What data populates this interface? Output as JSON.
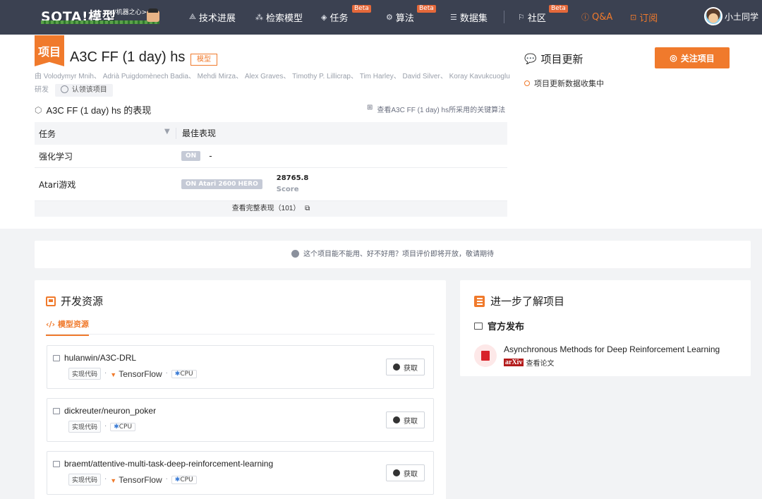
{
  "nav": {
    "logo_text": "SOTA!模型",
    "logo_sub": "</机器之心>",
    "items": [
      {
        "icon": "rocket-icon",
        "label": "技术进展"
      },
      {
        "icon": "nodes-icon",
        "label": "检索模型"
      },
      {
        "icon": "layers-icon",
        "label": "任务",
        "beta": "Beta"
      },
      {
        "icon": "algorithm-icon",
        "label": "算法",
        "beta": "Beta"
      },
      {
        "icon": "database-icon",
        "label": "数据集"
      },
      {
        "icon": "flag-icon",
        "label": "社区",
        "beta": "Beta"
      },
      {
        "icon": "question-icon",
        "label": "Q&A"
      },
      {
        "icon": "bookmark-icon",
        "label": "订阅"
      }
    ],
    "user": "小土同学"
  },
  "project": {
    "ribbon": "项目",
    "title": "A3C FF (1 day) hs",
    "badge": "模型",
    "authors": "由 Volodymyr Mnih、 Adrià Puigdomènech Badia、 Mehdi Mirza、 Alex Graves、 Timothy P. Lillicrap、 Tim Harley、 David Silver、 Koray Kavukcuoglu 研发",
    "claim": "认领该项目"
  },
  "performance": {
    "title": "A3C FF (1 day) hs 的表现",
    "link": "查看A3C FF (1 day) hs所采用的关键算法",
    "col_task": "任务",
    "col_best": "最佳表现",
    "rows": [
      {
        "task": "强化学习",
        "pill": "ON",
        "value": "-"
      },
      {
        "task": "Atari游戏",
        "pill": "ON Atari 2600 HERO",
        "value": "28765.8",
        "metric": "Score"
      }
    ],
    "footer": "查看完整表现（101）"
  },
  "updates": {
    "title": "项目更新",
    "follow": "关注项目",
    "status": "项目更新数据收集中"
  },
  "notice": "这个项目能不能用、好不好用？项目评价即将开放，敬请期待",
  "dev": {
    "title": "开发资源",
    "tab": "模型资源",
    "repos": [
      {
        "name": "hulanwin/A3C-DRL",
        "code": "实现代码",
        "framework": "TensorFlow",
        "hw": "CPU",
        "get": "获取"
      },
      {
        "name": "dickreuter/neuron_poker",
        "code": "实现代码",
        "framework": "",
        "hw": "CPU",
        "get": "获取"
      },
      {
        "name": "braemt/attentive-multi-task-deep-reinforcement-learning",
        "code": "实现代码",
        "framework": "TensorFlow",
        "hw": "CPU",
        "get": "获取"
      }
    ]
  },
  "learn": {
    "title": "进一步了解项目",
    "official": "官方发布",
    "paper_title": "Asynchronous Methods for Deep Reinforcement Learning",
    "arxiv": "arXiv",
    "paper_link": "查看论文"
  },
  "colors": {
    "accent": "#f07a2c",
    "nav_bg": "#3b4151",
    "page_bg": "#f2f3f5"
  }
}
